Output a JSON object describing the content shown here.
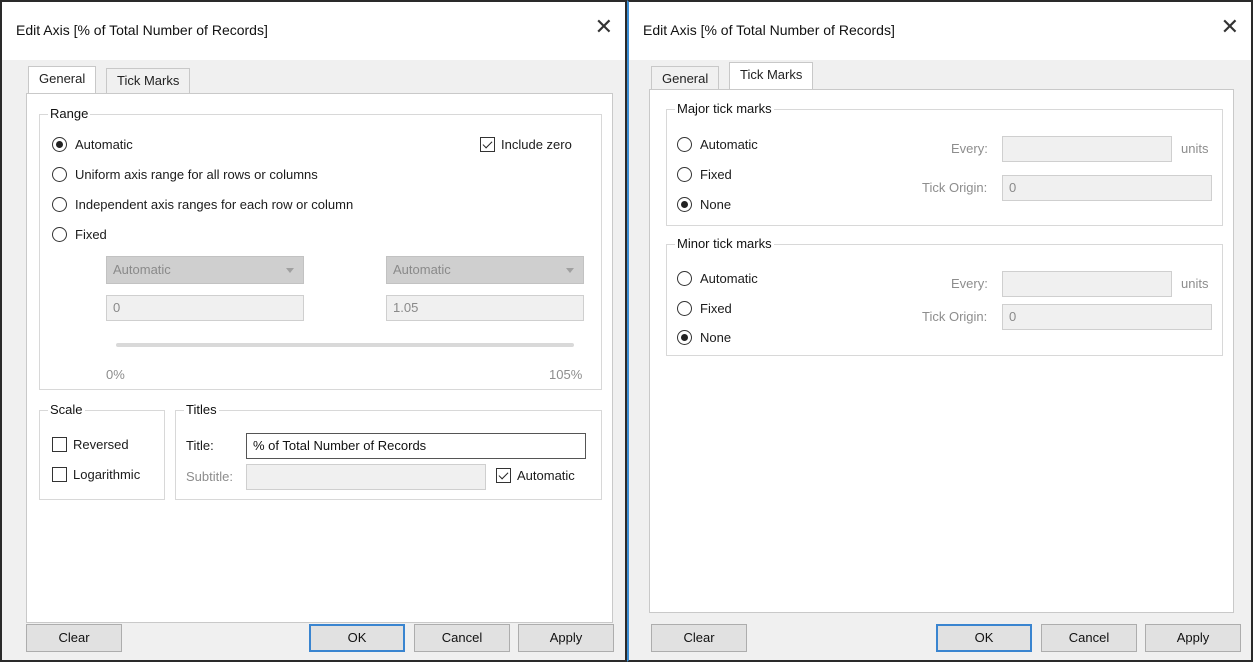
{
  "left_dialog": {
    "title": "Edit Axis [% of Total Number of Records]",
    "close_glyph": "✕",
    "tabs": [
      {
        "label": "General",
        "active": true
      },
      {
        "label": "Tick Marks",
        "active": false
      }
    ],
    "range": {
      "group_title": "Range",
      "options": [
        {
          "label": "Automatic",
          "selected": true
        },
        {
          "label": "Uniform axis range for all rows or columns",
          "selected": false
        },
        {
          "label": "Independent axis ranges for each row or column",
          "selected": false
        },
        {
          "label": "Fixed",
          "selected": false
        }
      ],
      "include_zero_label": "Include zero",
      "include_zero_checked": true,
      "start_select": "Automatic",
      "end_select": "Automatic",
      "start_value": "0",
      "end_value": "1.05",
      "slider_min_label": "0%",
      "slider_max_label": "105%"
    },
    "scale": {
      "group_title": "Scale",
      "reversed_label": "Reversed",
      "reversed_checked": false,
      "logarithmic_label": "Logarithmic",
      "logarithmic_checked": false
    },
    "titles": {
      "group_title": "Titles",
      "title_label": "Title:",
      "title_value": "% of Total Number of Records",
      "subtitle_label": "Subtitle:",
      "subtitle_value": "",
      "automatic_label": "Automatic",
      "automatic_checked": true
    },
    "buttons": {
      "clear": "Clear",
      "ok": "OK",
      "cancel": "Cancel",
      "apply": "Apply"
    }
  },
  "right_dialog": {
    "title": "Edit Axis [% of Total Number of Records]",
    "close_glyph": "✕",
    "tabs": [
      {
        "label": "General",
        "active": false
      },
      {
        "label": "Tick Marks",
        "active": true
      }
    ],
    "major": {
      "group_title": "Major tick marks",
      "options": [
        {
          "label": "Automatic",
          "selected": false
        },
        {
          "label": "Fixed",
          "selected": false
        },
        {
          "label": "None",
          "selected": true
        }
      ],
      "every_label": "Every:",
      "every_value": "",
      "units_label": "units",
      "origin_label": "Tick Origin:",
      "origin_value": "0"
    },
    "minor": {
      "group_title": "Minor tick marks",
      "options": [
        {
          "label": "Automatic",
          "selected": false
        },
        {
          "label": "Fixed",
          "selected": false
        },
        {
          "label": "None",
          "selected": true
        }
      ],
      "every_label": "Every:",
      "every_value": "",
      "units_label": "units",
      "origin_label": "Tick Origin:",
      "origin_value": "0"
    },
    "buttons": {
      "clear": "Clear",
      "ok": "OK",
      "cancel": "Cancel",
      "apply": "Apply"
    }
  },
  "colors": {
    "dialog_bg": "#f0f0f0",
    "panel_bg": "#ffffff",
    "default_button_border": "#3a85d0",
    "divider_accent": "#3c8fd6",
    "disabled_text": "#8d8d8d"
  }
}
